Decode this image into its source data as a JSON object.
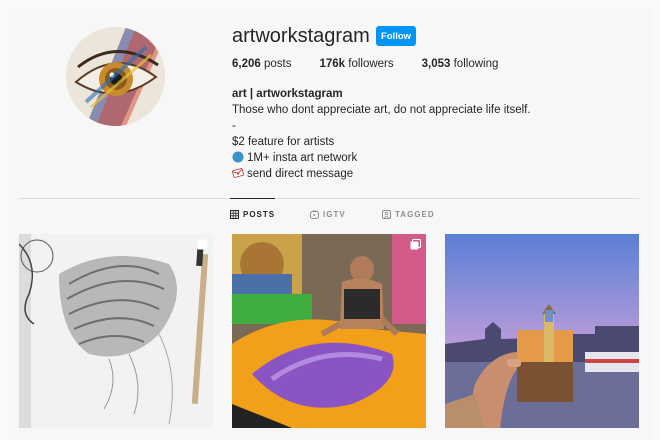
{
  "profile": {
    "username": "artworkstagram",
    "follow_label": "Follow",
    "stats": {
      "posts_count": "6,206",
      "posts_label": " posts",
      "followers_count": "176k",
      "followers_label": " followers",
      "following_count": "3,053",
      "following_label": " following"
    },
    "bio": {
      "name": "art | artworkstagram",
      "line1": "Those who dont appreciate art, do not appreciate life itself.",
      "line2": "-",
      "line3": "$2 feature for artists",
      "line4": "1M+ insta art network",
      "line5": "send direct message"
    }
  },
  "tabs": [
    {
      "label": "POSTS",
      "icon": "grid-icon",
      "active": true
    },
    {
      "label": "IGTV",
      "icon": "igtv-icon",
      "active": false
    },
    {
      "label": "TAGGED",
      "icon": "tagged-icon",
      "active": false
    }
  ],
  "posts": [
    {
      "subject": "pencil drawing of braided hair",
      "multi": true
    },
    {
      "subject": "man painting colorful canvas on floor",
      "multi": true
    },
    {
      "subject": "hand holding London photo at sunset",
      "multi": false
    }
  ],
  "colors": {
    "accent": "#0095f6",
    "text": "#262626",
    "muted": "#8e8e8e",
    "divider": "#dbdbdb"
  }
}
